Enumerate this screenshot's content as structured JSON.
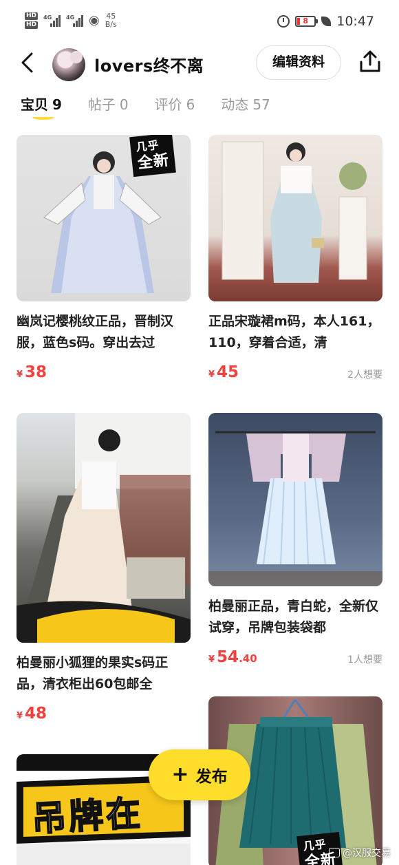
{
  "status_bar": {
    "hd_top": "HD",
    "hd_bottom": "HD",
    "sim1_net": "4G",
    "sim2_net": "4G",
    "speed_value": "45",
    "speed_unit": "B/s",
    "battery": "8",
    "time": "10:47"
  },
  "header": {
    "username": "lovers终不离",
    "edit_label": "编辑资料"
  },
  "tabs": [
    {
      "label": "宝贝",
      "count": "9"
    },
    {
      "label": "帖子",
      "count": "0"
    },
    {
      "label": "评价",
      "count": "6"
    },
    {
      "label": "动态",
      "count": "57"
    }
  ],
  "items": [
    {
      "title": "幽岚记樱桃纹正品，晋制汉服，蓝色s码。穿出去过",
      "yen": "¥",
      "price": "38",
      "price_dec": "",
      "want": "",
      "badge_line1": "几乎",
      "badge_line2": "全新"
    },
    {
      "title": "正品宋璇裙m码，本人161，110，穿着合适，清",
      "yen": "¥",
      "price": "45",
      "price_dec": "",
      "want": "2人想要"
    },
    {
      "title": "柏曼丽小狐狸的果实s码正品，清衣柜出60包邮全",
      "yen": "¥",
      "price": "48",
      "price_dec": "",
      "want": ""
    },
    {
      "title": "柏曼丽正品，青白蛇，全新仅试穿，吊牌包装袋都",
      "yen": "¥",
      "price": "54",
      "price_dec": ".40",
      "want": "1人想要"
    },
    {
      "badge_line1": "几乎",
      "badge_line2": "全新"
    },
    {
      "banner_text": "吊牌在"
    }
  ],
  "fab": {
    "label": "发布"
  },
  "watermark": "@汉服交易",
  "icons": {
    "back": "chevron-left-icon",
    "share": "share-upload-icon",
    "publish": "plus-icon"
  },
  "colors": {
    "accent_yellow": "#ffdd2b",
    "price_red": "#f0413f",
    "tab_inactive": "#9a9a9a"
  }
}
